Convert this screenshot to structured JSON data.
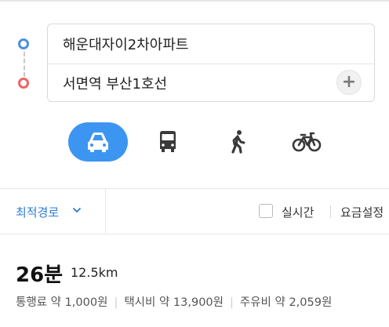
{
  "route": {
    "origin_value": "해운대자이2차아파트",
    "destination_value": "서면역 부산1호선",
    "add_waypoint_symbol": "+"
  },
  "modes": [
    {
      "name": "car",
      "icon": "car-icon",
      "active": true
    },
    {
      "name": "bus",
      "icon": "bus-icon",
      "active": false
    },
    {
      "name": "walk",
      "icon": "walking-person-icon",
      "active": false
    },
    {
      "name": "bicycle",
      "icon": "bicycle-icon",
      "active": false
    }
  ],
  "options": {
    "sort_label": "최적경로",
    "realtime_label": "실시간",
    "realtime_checked": false,
    "fare_settings_label": "요금설정"
  },
  "result": {
    "duration": "26분",
    "distance": "12.5km",
    "toll": "통행료 약 1,000원",
    "taxi": "택시비 약 13,900원",
    "fuel": "주유비 약 2,059원"
  },
  "colors": {
    "accent": "#3d95f2",
    "link": "#2d7bd8",
    "start_dot": "#4a90e2",
    "end_dot": "#f06262",
    "icon_dark": "#3a3a3a"
  }
}
